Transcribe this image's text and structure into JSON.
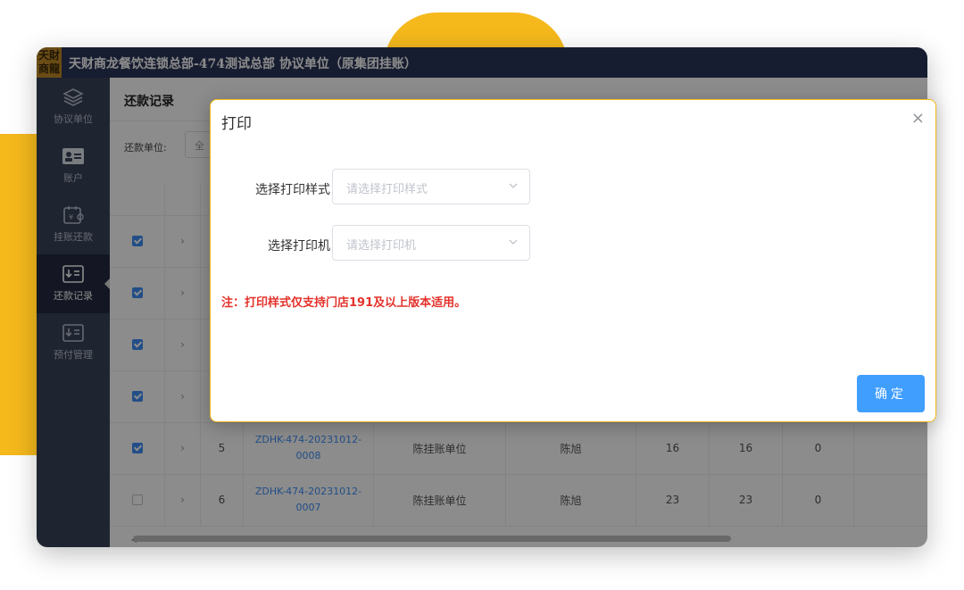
{
  "app": {
    "logo_text": "天財\n商龍",
    "title": "天财商龙餐饮连锁总部-474测试总部 协议单位（原集团挂账）"
  },
  "sidebar": {
    "items": [
      {
        "label": "协议单位",
        "icon": "layers-icon"
      },
      {
        "label": "账户",
        "icon": "id-card-icon"
      },
      {
        "label": "挂账还款",
        "icon": "calendar-money-icon"
      },
      {
        "label": "还款记录",
        "icon": "download-list-icon",
        "active": true
      },
      {
        "label": "预付管理",
        "icon": "download-list-icon"
      }
    ]
  },
  "main": {
    "page_title": "还款记录",
    "filter_label": "还款单位:",
    "filter_value": "全"
  },
  "table": {
    "rows": [
      {
        "checked": true,
        "index": "",
        "order": "",
        "unit": "",
        "operator": "",
        "amount": "",
        "paid": "",
        "remaining": ""
      },
      {
        "checked": true,
        "index": "",
        "order": "",
        "unit": "",
        "operator": "",
        "amount": "",
        "paid": "",
        "remaining": ""
      },
      {
        "checked": true,
        "index": "",
        "order": "",
        "unit": "",
        "operator": "",
        "amount": "",
        "paid": "",
        "remaining": ""
      },
      {
        "checked": true,
        "index": "",
        "order": "",
        "unit": "",
        "operator": "",
        "amount": "",
        "paid": "",
        "remaining": ""
      },
      {
        "checked": true,
        "index": "5",
        "order": "ZDHK-474-20231012-0008",
        "unit": "陈挂账单位",
        "operator": "陈旭",
        "amount": "16",
        "paid": "16",
        "remaining": "0"
      },
      {
        "checked": false,
        "index": "6",
        "order": "ZDHK-474-20231012-0007",
        "unit": "陈挂账单位",
        "operator": "陈旭",
        "amount": "23",
        "paid": "23",
        "remaining": "0"
      }
    ]
  },
  "dialog": {
    "title": "打印",
    "style_label": "选择打印样式",
    "style_placeholder": "请选择打印样式",
    "printer_label": "选择打印机",
    "printer_placeholder": "请选择打印机",
    "note": "注：打印样式仅支持门店191及以上版本适用。",
    "confirm_label": "确定",
    "close_glyph": "×"
  },
  "colors": {
    "accent": "#409eff",
    "titlebar": "#2b3558",
    "sidebar": "#3a4259",
    "warning": "#e4322b",
    "deco": "#f5b91c"
  }
}
